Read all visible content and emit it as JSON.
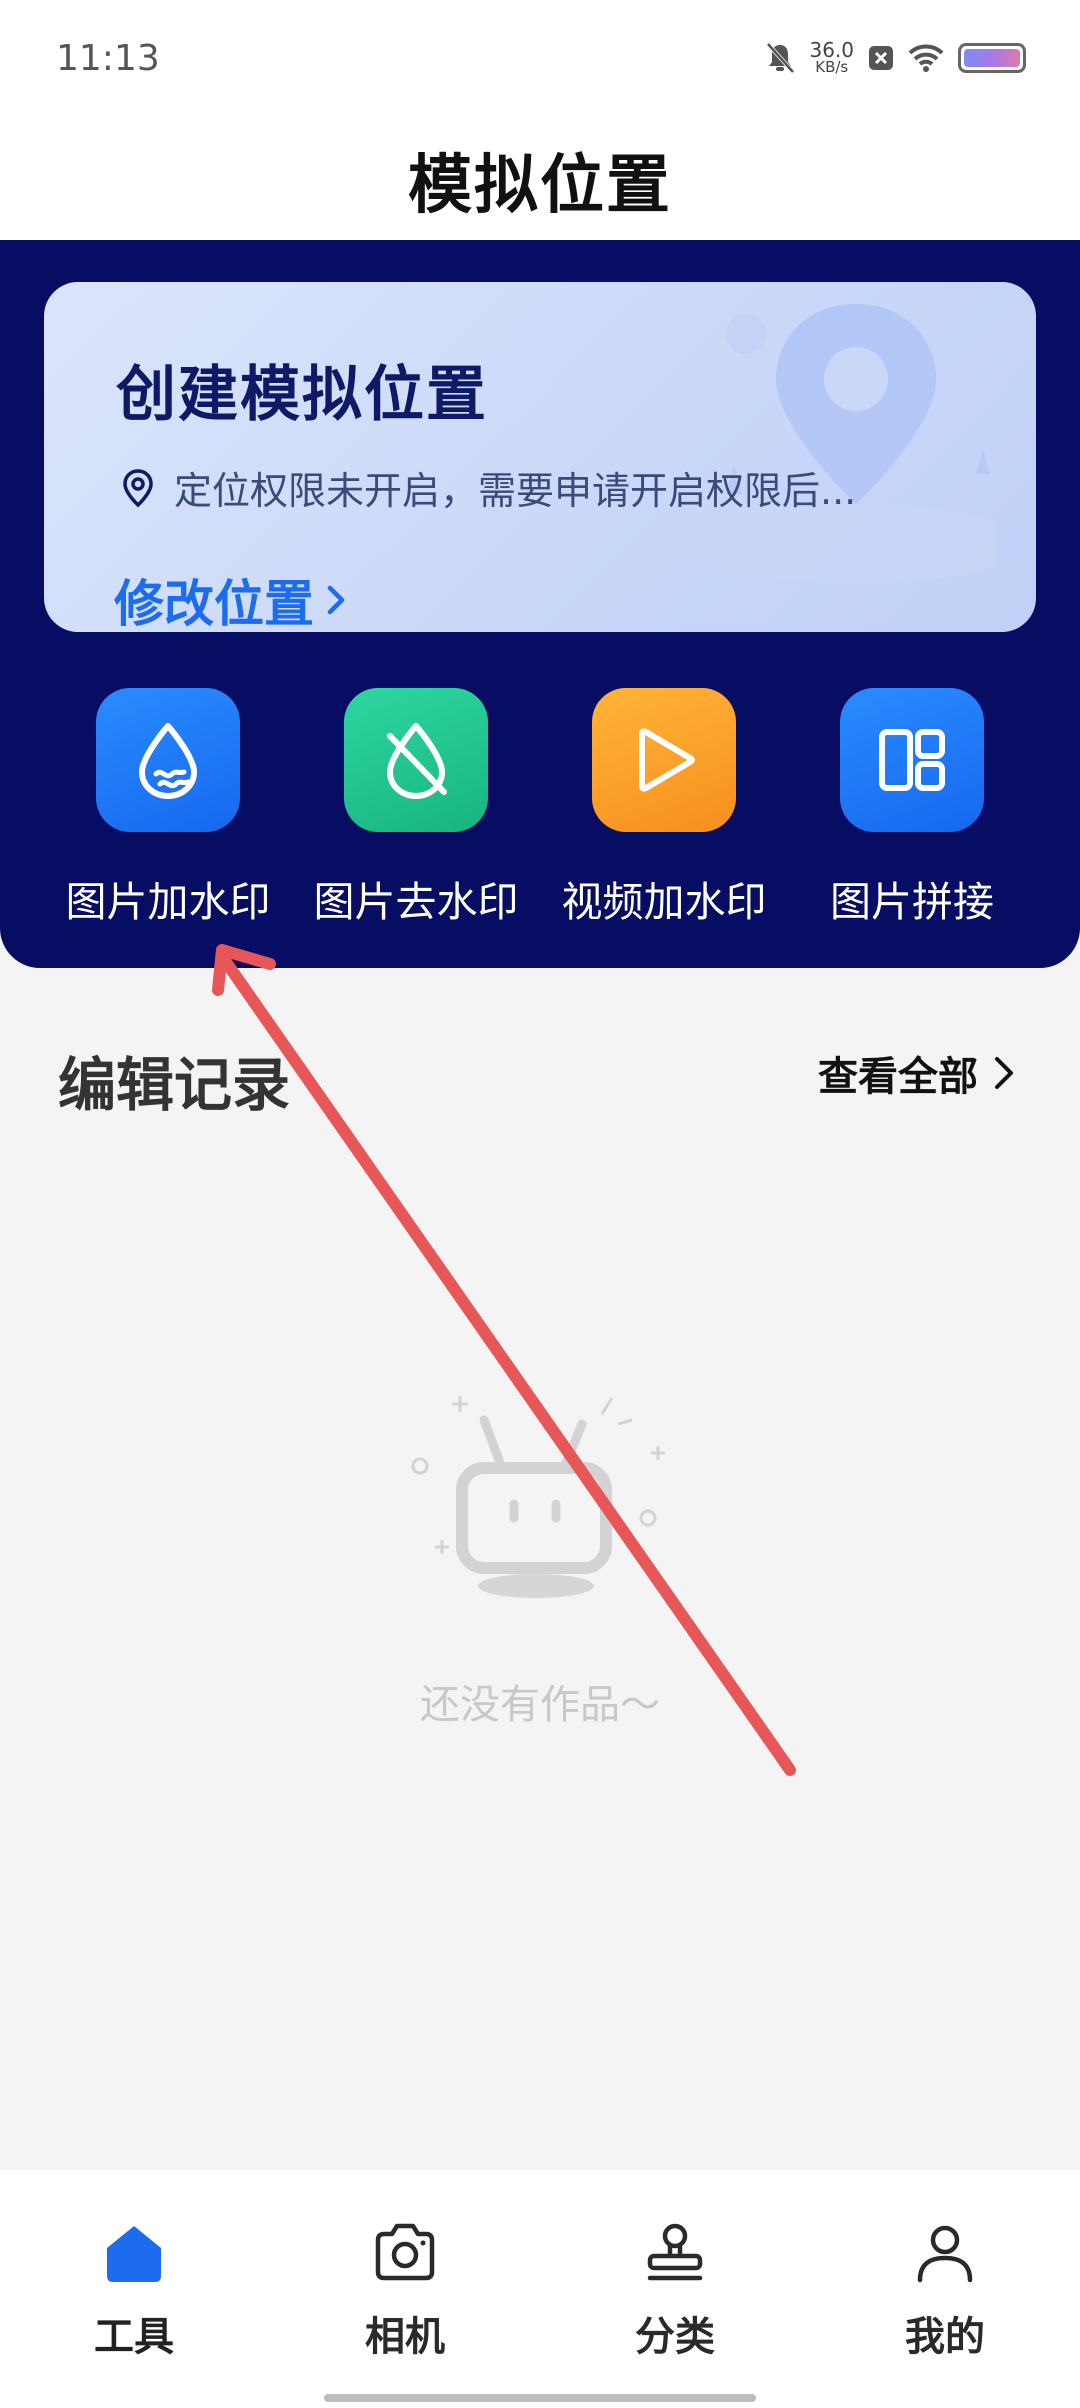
{
  "status_bar": {
    "time": "11:13",
    "network_speed": "36.0",
    "network_unit": "KB/s",
    "icons": [
      "mute-bell-icon",
      "close-box-icon",
      "wifi-icon",
      "battery-icon"
    ]
  },
  "header": {
    "title": "模拟位置"
  },
  "location_card": {
    "title": "创建模拟位置",
    "status": "定位权限未开启，需要申请开启权限后...",
    "link": "修改位置",
    "icon": "location-pin-icon"
  },
  "tools": [
    {
      "label": "图片加水印",
      "icon": "water-drop-icon",
      "color": "#1f7cf6"
    },
    {
      "label": "图片去水印",
      "icon": "no-water-drop-icon",
      "color": "#22c48e"
    },
    {
      "label": "视频加水印",
      "icon": "play-icon",
      "color": "#f9a127"
    },
    {
      "label": "图片拼接",
      "icon": "layout-grid-icon",
      "color": "#1f7cf6"
    }
  ],
  "records": {
    "title": "编辑记录",
    "view_all": "查看全部",
    "empty_text": "还没有作品～"
  },
  "bottom_nav": [
    {
      "label": "工具",
      "icon": "home-icon",
      "active": true
    },
    {
      "label": "相机",
      "icon": "camera-icon",
      "active": false
    },
    {
      "label": "分类",
      "icon": "stamp-icon",
      "active": false
    },
    {
      "label": "我的",
      "icon": "user-icon",
      "active": false
    }
  ],
  "colors": {
    "panel_bg": "#070d62",
    "accent_blue": "#1d6cf0",
    "annotation_red": "#e85757"
  }
}
